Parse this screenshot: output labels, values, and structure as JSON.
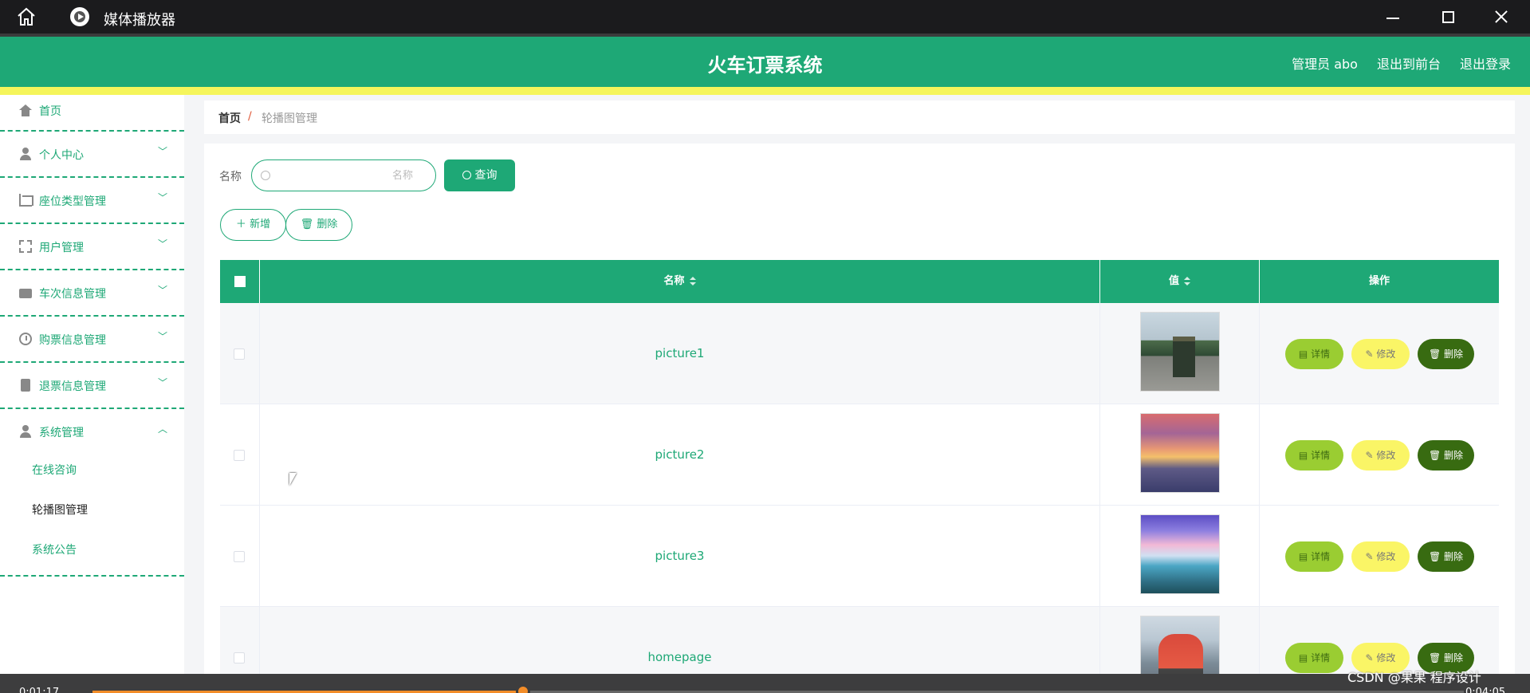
{
  "player": {
    "title": "媒体播放器",
    "current_time": "0:01:17",
    "total_time": "0:04:05",
    "progress_fraction": 0.314,
    "watermark": "CSDN @果果 程序设计"
  },
  "app": {
    "title": "火车订票系统",
    "header_links": [
      "管理员 abo",
      "退出到前台",
      "退出登录"
    ],
    "accent_color": "#1ea876"
  },
  "sidebar": {
    "items": [
      {
        "label": "首页",
        "icon": "home-icon"
      },
      {
        "label": "个人中心",
        "icon": "user-icon"
      },
      {
        "label": "座位类型管理",
        "icon": "crop-icon"
      },
      {
        "label": "用户管理",
        "icon": "scan-icon"
      },
      {
        "label": "车次信息管理",
        "icon": "wallet-icon"
      },
      {
        "label": "购票信息管理",
        "icon": "clock-icon"
      },
      {
        "label": "退票信息管理",
        "icon": "clipboard-icon"
      },
      {
        "label": "系统管理",
        "icon": "user-icon"
      }
    ],
    "sub_items": [
      "在线咨询",
      "轮播图管理",
      "系统公告"
    ],
    "active_sub_item": "轮播图管理"
  },
  "breadcrumb": {
    "home": "首页",
    "separator": "/",
    "current": "轮播图管理"
  },
  "search": {
    "label": "名称",
    "placeholder": "名称",
    "query_button": "查询"
  },
  "actions": {
    "add": "新增",
    "delete": "删除"
  },
  "table": {
    "headers": [
      "名称",
      "值",
      "操作"
    ],
    "rows": [
      {
        "name": "picture1",
        "thumb": "train-on-tracks-image"
      },
      {
        "name": "picture2",
        "thumb": "sunset-city-image"
      },
      {
        "name": "picture3",
        "thumb": "blue-sky-lake-image"
      },
      {
        "name": "homepage",
        "thumb": "red-train-image"
      }
    ],
    "row_actions": {
      "detail": "详情",
      "edit": "修改",
      "delete": "删除"
    }
  }
}
